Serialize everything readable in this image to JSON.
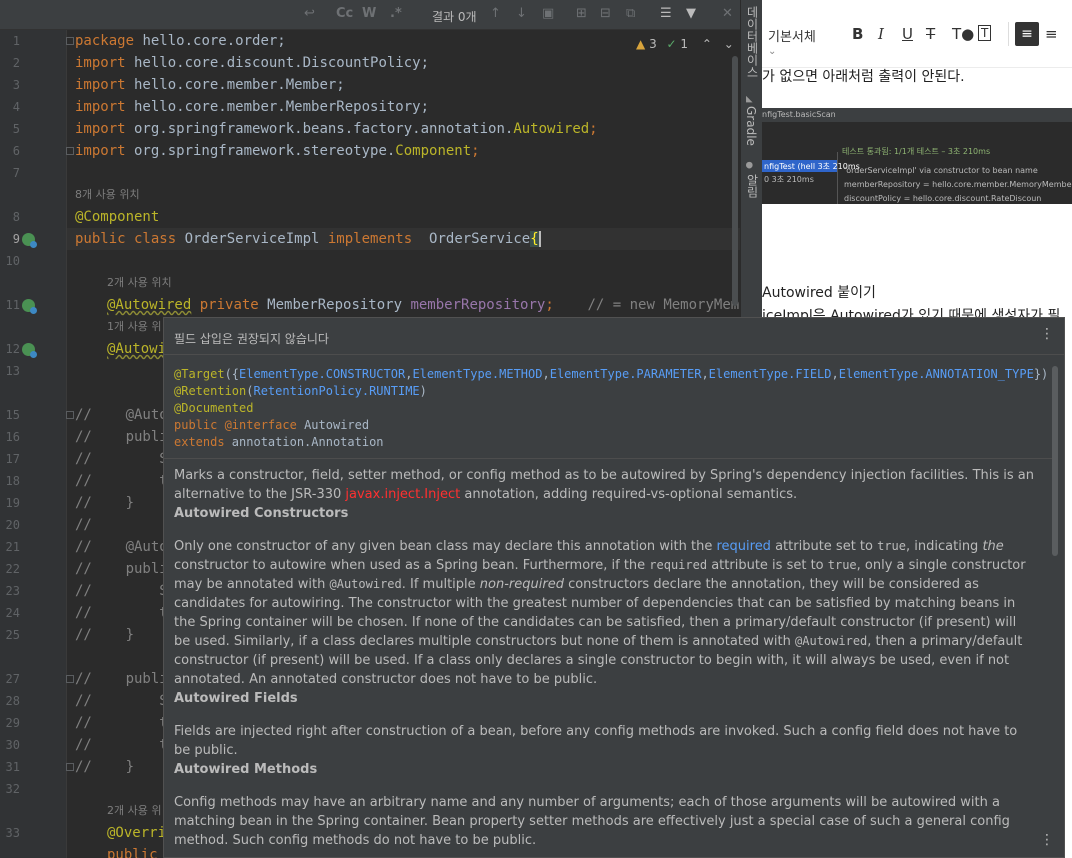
{
  "findbar": {
    "result_label": "결과 0개",
    "btn_cc": "Cc",
    "btn_w": "W",
    "btn_regex": ".*"
  },
  "inspection": {
    "warn_count": "3",
    "ok_count": "1"
  },
  "side_tools": {
    "database_label": "데이터베이스",
    "gradle_label": "Gradle",
    "notifications_label": "알림"
  },
  "line_numbers": [
    "1",
    "2",
    "3",
    "4",
    "5",
    "6",
    "7",
    "8",
    "9",
    "10",
    "11",
    "12",
    "13",
    "15",
    "16",
    "17",
    "18",
    "19",
    "20",
    "21",
    "22",
    "23",
    "24",
    "25",
    "27",
    "28",
    "29",
    "30",
    "31",
    "32",
    "33"
  ],
  "code": {
    "l1_kw": "package",
    "l1_rest": " hello.core.order;",
    "import_kw": "import",
    "l2": " hello.core.discount.DiscountPolicy;",
    "l3": " hello.core.member.Member;",
    "l4": " hello.core.member.MemberRepository;",
    "l5_pre": " org.springframework.beans.factory.annotation.",
    "l5_ann": "Autowired",
    "l6_pre": " org.springframework.stereotype.",
    "l6_ann": "Component",
    "semicolon": ";",
    "hint_8_uses": "8개 사용 위치",
    "l8_ann": "@Component",
    "l9_kw1": "public class",
    "l9_name": " OrderServiceImpl ",
    "l9_kw2": "implements",
    "l9_iface": "  OrderService",
    "l9_brace": "{",
    "hint_2_uses": "2개 사용 위치",
    "l11_ann": "@Autowired",
    "l11_kw": " private",
    "l11_type": " MemberRepository ",
    "l11_field": "memberRepository",
    "l11_end": ";",
    "l11_cmt": "    // = new MemoryMemberR",
    "hint_1_use": "1개 사용 위",
    "l12_ann": "@Autowi",
    "l15": "//    @Auto",
    "l16": "//    publi",
    "l17": "//        S",
    "l18": "//        t",
    "l19": "//    }",
    "l20": "//",
    "l21": "//    @Auto",
    "l22": "//    publi",
    "l23": "//        S",
    "l24": "//        t",
    "l25": "//    }",
    "l27": "//    publi",
    "l28": "//        S",
    "l29": "//        t",
    "l30": "//        t",
    "l31": "//    }",
    "hint_2_uses_b": "2개 사용 위",
    "l33_ann": "@Overri",
    "l34_kw": "public"
  },
  "blog": {
    "font_select": "기본서체",
    "bold": "B",
    "italic": "I",
    "underline": "U",
    "strike": "T",
    "text1": "가 없으면 아래처럼 출력이 안된다.",
    "heading": "Autowired 붙이기",
    "text2": "iceImpl은 Autowired가 있기 때문에 생성자가 필",
    "shot": {
      "tab": "nfigTest.basicScan",
      "status": "테스트 통과됨: 1/1개 테스트 – 3초 210ms",
      "tree_item": "nfigTest (hell 3초 210ms",
      "tree_sub": "0                3초 210ms",
      "log1": "'orderServiceImpl' via constructor to bean name",
      "log2": "memberRepository = hello.core.member.MemoryMembe",
      "log3": "discountPolicy = hello.core.discount.RateDiscoun"
    }
  },
  "popup": {
    "title": "필드 삽입은 권장되지 않습니다",
    "menu": "⋮",
    "sig_target": "@Target",
    "sig_target_open": "({",
    "sig_target_items": [
      "ElementType.CONSTRUCTOR",
      "ElementType.METHOD",
      "ElementType.PARAMETER",
      "ElementType.FIELD",
      "ElementType.ANNOTATION_TYPE"
    ],
    "sig_target_close": "})",
    "sig_retention": "@Retention",
    "sig_retention_arg": "RetentionPolicy.RUNTIME",
    "sig_documented": "@Documented",
    "sig_public": "public",
    "sig_interface": " @interface",
    "sig_name": " Autowired",
    "sig_extends": "extends",
    "sig_extends_type": " annotation.Annotation",
    "intro_1": "Marks a constructor, field, setter method, or config method as to be autowired by Spring's dependency injection facilities. This is an alternative to the JSR-330 ",
    "intro_link": "javax.inject.Inject",
    "intro_2": " annotation, adding required-vs-optional semantics.",
    "h_constructors": "Autowired Constructors",
    "c_1": "Only one constructor of any given bean class may declare this annotation with the ",
    "c_required_link": "required",
    "c_2": " attribute set to ",
    "c_true1": "true",
    "c_3": ", indicating ",
    "c_the": "the",
    "c_4": " constructor to autowire when used as a Spring bean. Furthermore, if the ",
    "c_required": "required",
    "c_5": " attribute is set to ",
    "c_true2": "true",
    "c_6": ", only a single constructor may be annotated with ",
    "c_autowired1": "@Autowired",
    "c_7": ". If multiple ",
    "c_nonreq": "non-required",
    "c_8": " constructors declare the annotation, they will be considered as candidates for autowiring. The constructor with the greatest number of dependencies that can be satisfied by matching beans in the Spring container will be chosen. If none of the candidates can be satisfied, then a primary/default constructor (if present) will be used. Similarly, if a class declares multiple constructors but none of them is annotated with ",
    "c_autowired2": "@Autowired",
    "c_9": ", then a primary/default constructor (if present) will be used. If a class only declares a single constructor to begin with, it will always be used, even if not annotated. An annotated constructor does not have to be public.",
    "h_fields": "Autowired Fields",
    "f_1": "Fields are injected right after construction of a bean, before any config methods are invoked. Such a config field does not have to be public.",
    "h_methods": "Autowired Methods",
    "m_1": "Config methods may have an arbitrary name and any number of arguments; each of those arguments will be autowired with a matching bean in the Spring container. Bean property setter methods are effectively just a special case of such a general config method. Such config methods do not have to be public."
  }
}
